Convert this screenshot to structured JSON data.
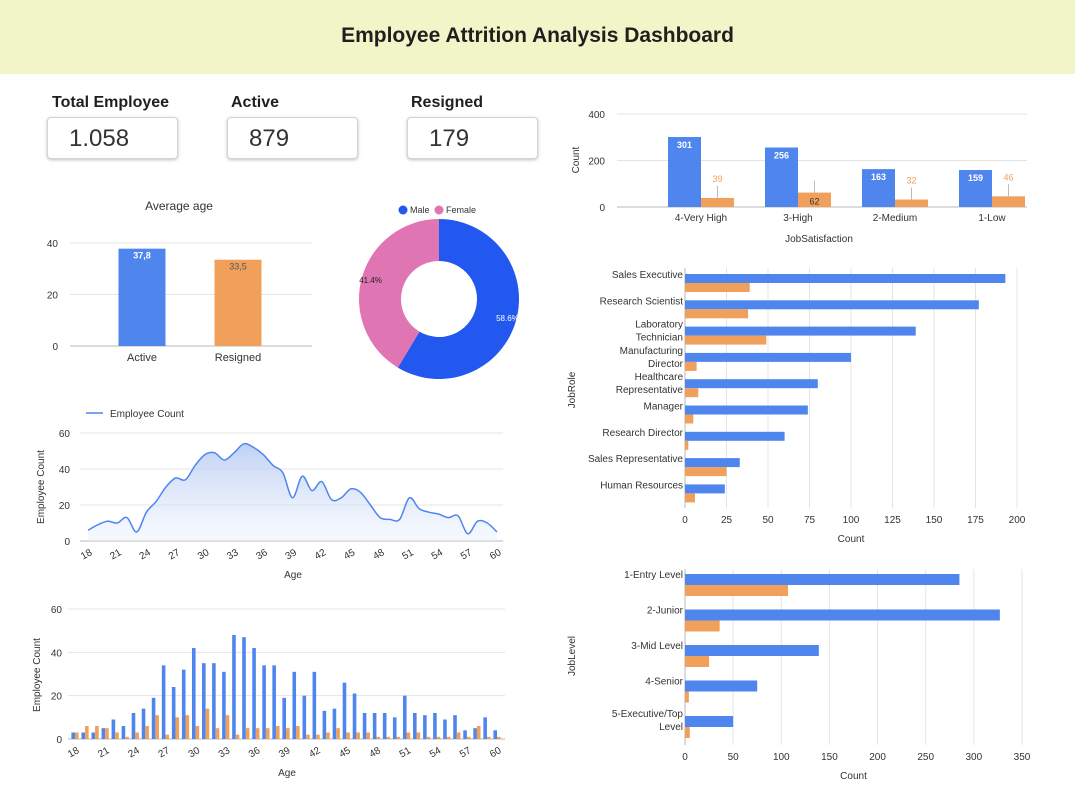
{
  "header": {
    "title": "Employee Attrition Analysis Dashboard"
  },
  "kpis": [
    {
      "label": "Total Employee",
      "value": "1.058"
    },
    {
      "label": "Active",
      "value": "879"
    },
    {
      "label": "Resigned",
      "value": "179"
    }
  ],
  "colors": {
    "blue": "#4f86ee",
    "orange": "#f0a05a",
    "donut_blue": "#2258ef",
    "donut_pink": "#e075b3",
    "header_bg": "#f2f5c8"
  },
  "chart_data": [
    {
      "id": "avg_age",
      "type": "bar",
      "title": "Average age",
      "categories": [
        "Active",
        "Resigned"
      ],
      "values": [
        37.8,
        33.5
      ],
      "value_labels": [
        "37,8",
        "33,5"
      ],
      "ylim": [
        0,
        40
      ],
      "yticks": [
        "0",
        "20",
        "40"
      ]
    },
    {
      "id": "gender",
      "type": "pie",
      "legend": [
        "Male",
        "Female"
      ],
      "values": [
        58.6,
        41.4
      ],
      "value_labels": [
        "58.6%",
        "41.4%"
      ]
    },
    {
      "id": "job_satisfaction",
      "type": "bar",
      "categories": [
        "4-Very High",
        "3-High",
        "2-Medium",
        "1-Low"
      ],
      "series": [
        {
          "values": [
            301,
            256,
            163,
            159
          ]
        },
        {
          "values": [
            39,
            62,
            32,
            46
          ]
        }
      ],
      "xlabel": "JobSatisfaction",
      "ylabel": "Count",
      "ylim": [
        0,
        400
      ],
      "yticks": [
        "0",
        "200",
        "400"
      ]
    },
    {
      "id": "age_line",
      "type": "area",
      "legend": "Employee Count",
      "x": [
        18,
        19,
        20,
        21,
        22,
        23,
        24,
        25,
        26,
        27,
        28,
        29,
        30,
        31,
        32,
        33,
        34,
        35,
        36,
        37,
        38,
        39,
        40,
        41,
        42,
        43,
        44,
        45,
        46,
        47,
        48,
        49,
        50,
        51,
        52,
        53,
        54,
        55,
        56,
        57,
        58,
        59,
        60
      ],
      "values": [
        6,
        9,
        11,
        10,
        13,
        5,
        16,
        22,
        30,
        35,
        34,
        42,
        48,
        49,
        45,
        49,
        54,
        52,
        48,
        42,
        38,
        24,
        36,
        28,
        33,
        23,
        24,
        29,
        27,
        20,
        13,
        12,
        12,
        24,
        18,
        16,
        15,
        13,
        14,
        4,
        11,
        10,
        5
      ],
      "xticks": [
        "18",
        "21",
        "24",
        "27",
        "30",
        "33",
        "36",
        "39",
        "42",
        "45",
        "48",
        "51",
        "54",
        "57",
        "60"
      ],
      "xlabel": "Age",
      "ylabel": "Employee Count",
      "ylim": [
        0,
        60
      ],
      "yticks": [
        "0",
        "20",
        "40",
        "60"
      ]
    },
    {
      "id": "age_bar",
      "type": "bar",
      "x": [
        18,
        19,
        20,
        21,
        22,
        23,
        24,
        25,
        26,
        27,
        28,
        29,
        30,
        31,
        32,
        33,
        34,
        35,
        36,
        37,
        38,
        39,
        40,
        41,
        42,
        43,
        44,
        45,
        46,
        47,
        48,
        49,
        50,
        51,
        52,
        53,
        54,
        55,
        56,
        57,
        58,
        59,
        60
      ],
      "series": [
        {
          "values": [
            3,
            3,
            3,
            5,
            9,
            6,
            12,
            14,
            19,
            34,
            24,
            32,
            42,
            35,
            35,
            31,
            48,
            47,
            42,
            34,
            34,
            19,
            31,
            20,
            31,
            13,
            14,
            26,
            21,
            12,
            12,
            12,
            10,
            20,
            12,
            11,
            12,
            9,
            11,
            4,
            5,
            10,
            4
          ]
        },
        {
          "values": [
            3,
            6,
            6,
            5,
            3,
            1,
            3,
            6,
            11,
            2,
            10,
            11,
            6,
            14,
            5,
            11,
            2,
            5,
            5,
            5,
            6,
            5,
            6,
            2,
            2,
            3,
            5,
            3,
            3,
            3,
            1,
            1,
            1,
            3,
            3,
            1,
            1,
            1,
            3,
            1,
            6,
            1,
            1
          ]
        }
      ],
      "xticks": [
        "18",
        "21",
        "24",
        "27",
        "30",
        "33",
        "36",
        "39",
        "42",
        "45",
        "48",
        "51",
        "54",
        "57",
        "60"
      ],
      "xlabel": "Age",
      "ylabel": "Employee Count",
      "ylim": [
        0,
        60
      ],
      "yticks": [
        "0",
        "20",
        "40",
        "60"
      ]
    },
    {
      "id": "job_role",
      "type": "bar",
      "orientation": "horizontal",
      "categories": [
        [
          "Sales Executive"
        ],
        [
          "Research Scientist"
        ],
        [
          "Laboratory",
          "Technician"
        ],
        [
          "Manufacturing",
          "Director"
        ],
        [
          "Healthcare",
          "Representative"
        ],
        [
          "Manager"
        ],
        [
          "Research Director"
        ],
        [
          "Sales Representative"
        ],
        [
          "Human Resources"
        ]
      ],
      "series": [
        {
          "values": [
            193,
            177,
            139,
            100,
            80,
            74,
            60,
            33,
            24
          ]
        },
        {
          "values": [
            39,
            38,
            49,
            7,
            8,
            5,
            2,
            25,
            6
          ]
        }
      ],
      "xlabel": "Count",
      "ylabel": "JobRole",
      "xlim": [
        0,
        200
      ],
      "xticks": [
        "0",
        "25",
        "50",
        "75",
        "100",
        "125",
        "150",
        "175",
        "200"
      ]
    },
    {
      "id": "job_level",
      "type": "bar",
      "orientation": "horizontal",
      "categories": [
        [
          "1-Entry Level"
        ],
        [
          "2-Junior"
        ],
        [
          "3-Mid Level"
        ],
        [
          "4-Senior"
        ],
        [
          "5-Executive/Top",
          "Level"
        ]
      ],
      "series": [
        {
          "values": [
            285,
            327,
            139,
            75,
            50
          ]
        },
        {
          "values": [
            107,
            36,
            25,
            4,
            5
          ]
        }
      ],
      "xlabel": "Count",
      "ylabel": "JobLevel",
      "xlim": [
        0,
        350
      ],
      "xticks": [
        "0",
        "50",
        "100",
        "150",
        "200",
        "250",
        "300",
        "350"
      ]
    }
  ]
}
